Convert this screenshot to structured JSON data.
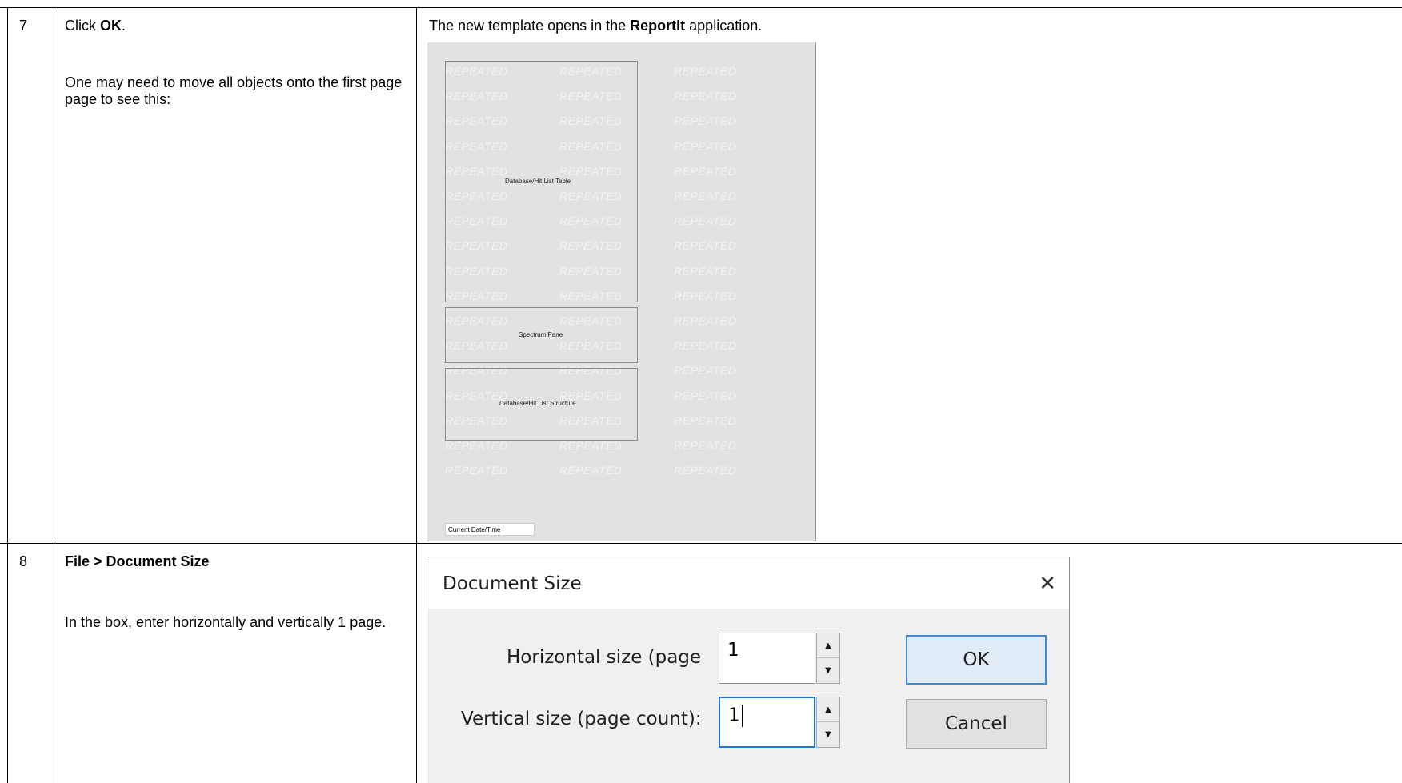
{
  "steps": [
    {
      "number": "7",
      "action_prefix": "Click ",
      "action_bold": "OK",
      "action_suffix": ".",
      "note": "One may need to move all objects onto the first page page to see this:",
      "result_prefix": "The new template opens in the ",
      "result_bold": "ReportIt",
      "result_suffix": " application."
    },
    {
      "number": "8",
      "action": "File > Document Size",
      "note": "In the box, enter horizontally and vertically 1 page."
    }
  ],
  "preview": {
    "watermark": "REPEATED",
    "objects": {
      "table": "Database/Hit List Table",
      "spectrum": "Spectrum Pane",
      "structure": "Database/Hit List Structure",
      "datetime": "Current Date/Time"
    }
  },
  "dialog": {
    "title": "Document Size",
    "close_icon": "close-icon",
    "horizontal_label": "Horizontal size (page",
    "horizontal_value": "1",
    "vertical_label": "Vertical size (page count):",
    "vertical_value": "1",
    "ok_label": "OK",
    "cancel_label": "Cancel"
  }
}
